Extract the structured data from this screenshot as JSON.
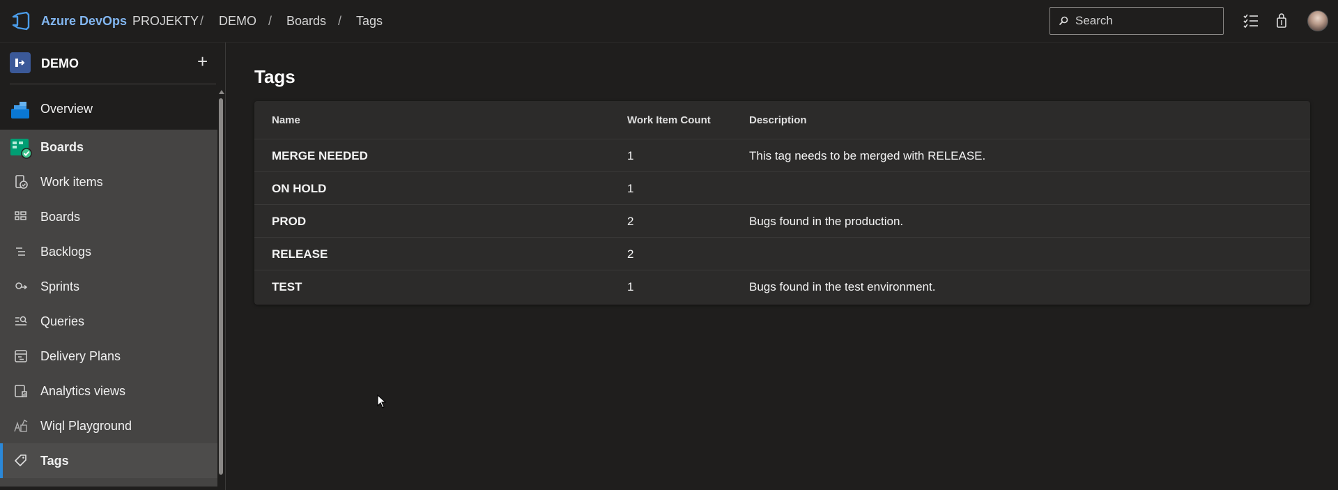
{
  "header": {
    "brand": "Azure DevOps",
    "breadcrumbs": [
      {
        "label": "PROJEKTY"
      },
      {
        "label": "DEMO"
      },
      {
        "label": "Boards"
      },
      {
        "label": "Tags"
      }
    ],
    "separator": "/",
    "search_placeholder": "Search"
  },
  "sidebar": {
    "project_name": "DEMO",
    "add_label": "+",
    "overview_label": "Overview",
    "boards_label": "Boards",
    "items": [
      {
        "label": "Work items",
        "icon": "work-items-icon"
      },
      {
        "label": "Boards",
        "icon": "boards-icon"
      },
      {
        "label": "Backlogs",
        "icon": "backlogs-icon"
      },
      {
        "label": "Sprints",
        "icon": "sprints-icon"
      },
      {
        "label": "Queries",
        "icon": "queries-icon"
      },
      {
        "label": "Delivery Plans",
        "icon": "delivery-plans-icon"
      },
      {
        "label": "Analytics views",
        "icon": "analytics-views-icon"
      },
      {
        "label": "Wiql Playground",
        "icon": "wiql-playground-icon"
      },
      {
        "label": "Tags",
        "icon": "tag-icon",
        "active": true
      }
    ]
  },
  "main": {
    "title": "Tags",
    "columns": {
      "name": "Name",
      "count": "Work Item Count",
      "description": "Description"
    },
    "rows": [
      {
        "name": "MERGE NEEDED",
        "count": "1",
        "description": "This tag needs to be merged with RELEASE."
      },
      {
        "name": "ON HOLD",
        "count": "1",
        "description": ""
      },
      {
        "name": "PROD",
        "count": "2",
        "description": "Bugs found in the production."
      },
      {
        "name": "RELEASE",
        "count": "2",
        "description": ""
      },
      {
        "name": "TEST",
        "count": "1",
        "description": "Bugs found in the test environment."
      }
    ]
  },
  "colors": {
    "accent": "#2b88d8",
    "brand": "#82b6f0",
    "background": "#1f1e1d",
    "card": "#2c2b2a"
  }
}
